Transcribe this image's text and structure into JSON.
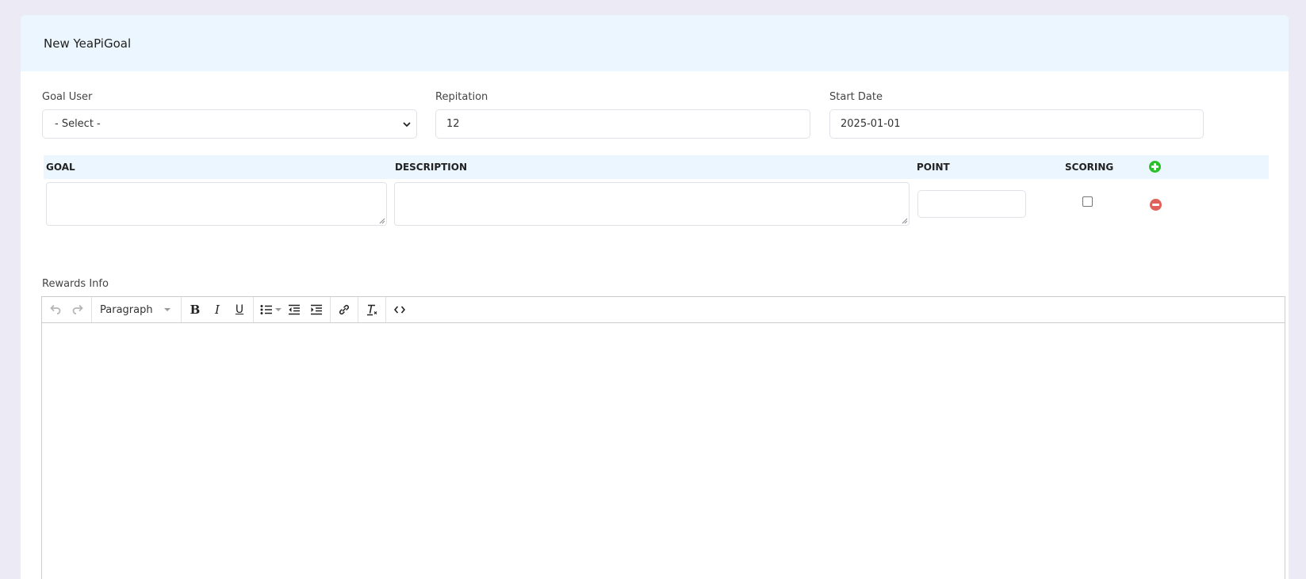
{
  "form": {
    "title": "New YeaPiGoal"
  },
  "fields": {
    "goal_user": {
      "label": "Goal User",
      "selected": "- Select -"
    },
    "repitation": {
      "label": "Repitation",
      "value": "12"
    },
    "start_date": {
      "label": "Start Date",
      "value": "2025-01-01"
    }
  },
  "goals_table": {
    "columns": {
      "goal": "GOAL",
      "description": "DESCRIPTION",
      "point": "POINT",
      "scoring": "SCORING"
    },
    "rows": [
      {
        "goal": "",
        "description": "",
        "point": "",
        "scoring": false
      }
    ]
  },
  "rewards": {
    "label": "Rewards Info",
    "toolbar": {
      "block_format": "Paragraph",
      "buttons": [
        "undo",
        "redo",
        "bold",
        "italic",
        "underline",
        "bullet-list",
        "outdent",
        "indent",
        "link",
        "clear-formatting",
        "source-code"
      ]
    },
    "content": ""
  },
  "colors": {
    "header_bg": "#ebf6fe",
    "add_icon": "#2bbf2b",
    "remove_icon": "#e0605a"
  }
}
